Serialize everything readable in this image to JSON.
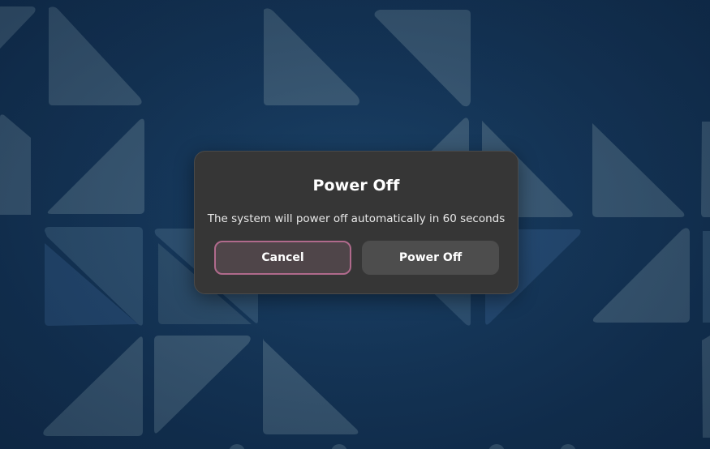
{
  "dialog": {
    "title": "Power Off",
    "message": "The system will power off automatically in 60 seconds",
    "cancel_label": "Cancel",
    "confirm_label": "Power Off"
  },
  "theme": {
    "dialog_background": "#363636",
    "focus_ring": "#b06a8c",
    "wallpaper_base": "#1a4168"
  }
}
